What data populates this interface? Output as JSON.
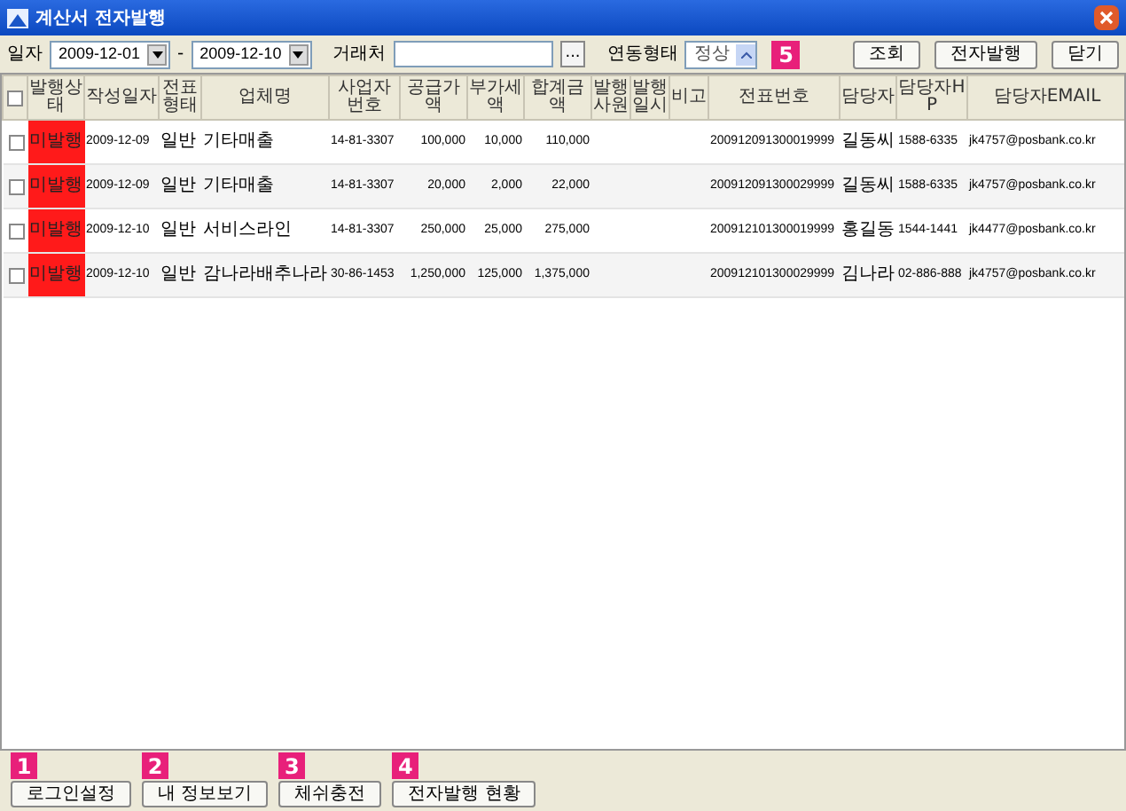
{
  "window": {
    "title": "계산서 전자발행"
  },
  "filters": {
    "date_label": "일자",
    "date_from": "2009-12-01",
    "date_sep": "-",
    "date_to": "2009-12-10",
    "client_label": "거래처",
    "browse_button": "...",
    "link_label": "연동형태",
    "link_value": "정상",
    "badge": "5"
  },
  "buttons": [
    "조회",
    "전자발행",
    "닫기"
  ],
  "table": {
    "select_all_checked": false,
    "columns": [
      "발행상태",
      "작성일자",
      "전표형태",
      "업체명",
      "사업자번호",
      "공급가액",
      "부가세액",
      "합계금액",
      "발행사원",
      "발행일시",
      "비고",
      "전표번호",
      "담당자",
      "담당자HP",
      "담당자EMAIL"
    ],
    "rows": [
      {
        "checked": false,
        "cells": [
          "미발행",
          "2009-12-09",
          "일반",
          "기타매출",
          "14-81-3307",
          "100,000",
          "10,000",
          "110,000",
          "",
          "",
          "",
          "200912091300019999",
          "길동씨",
          "1588-6335",
          "jk4757@posbank.co.kr"
        ]
      },
      {
        "checked": false,
        "cells": [
          "미발행",
          "2009-12-09",
          "일반",
          "기타매출",
          "14-81-3307",
          "20,000",
          "2,000",
          "22,000",
          "",
          "",
          "",
          "200912091300029999",
          "길동씨",
          "1588-6335",
          "jk4757@posbank.co.kr"
        ]
      },
      {
        "checked": false,
        "cells": [
          "미발행",
          "2009-12-10",
          "일반",
          "서비스라인",
          "14-81-3307",
          "250,000",
          "25,000",
          "275,000",
          "",
          "",
          "",
          "200912101300019999",
          "홍길동",
          "1544-1441",
          "jk4477@posbank.co.kr"
        ]
      },
      {
        "checked": false,
        "cells": [
          "미발행",
          "2009-12-10",
          "일반",
          "감나라배추나라",
          "30-86-1453",
          "1,250,000",
          "125,000",
          "1,375,000",
          "",
          "",
          "",
          "200912101300029999",
          "김나라",
          "02-886-888",
          "jk4757@posbank.co.kr"
        ]
      }
    ]
  },
  "footer": {
    "buttons": [
      {
        "badge": "1",
        "label": "로그인설정"
      },
      {
        "badge": "2",
        "label": "내 정보보기"
      },
      {
        "badge": "3",
        "label": "체쉬충전"
      },
      {
        "badge": "4",
        "label": "전자발행 현황"
      }
    ]
  }
}
